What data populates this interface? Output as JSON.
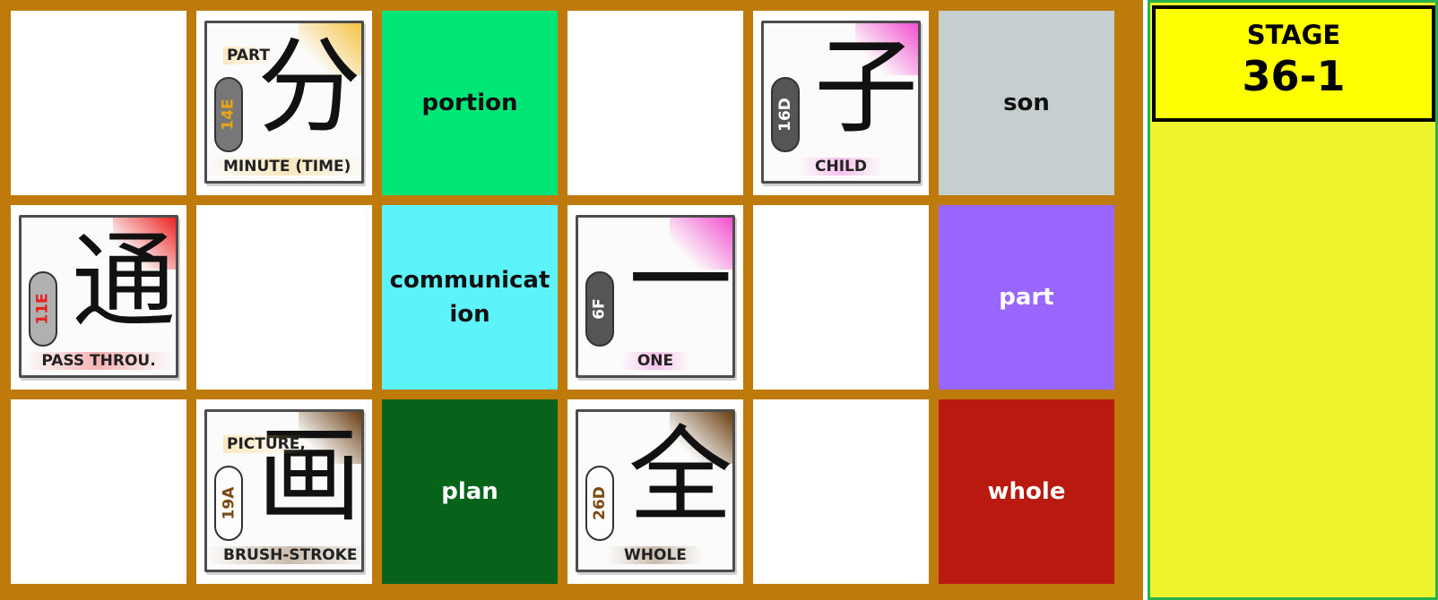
{
  "stage": {
    "label": "STAGE",
    "number": "36-1"
  },
  "colors": {
    "board": "#bf7a0c",
    "panel": "#eef52e",
    "panel_border": "#29b14e",
    "header": "#ffff00"
  },
  "cells": [
    {
      "type": "empty"
    },
    {
      "type": "kanji",
      "glyph": "分",
      "top": "PART",
      "bottom": "MINUTE (TIME)",
      "badge": "14E",
      "badge_text_color": "#e8a317",
      "badge_fill": "#777777",
      "accent": "#f5c242"
    },
    {
      "type": "word",
      "text": "portion",
      "bg": "#00e676",
      "fg": "#111111"
    },
    {
      "type": "empty"
    },
    {
      "type": "kanji",
      "glyph": "子",
      "top": "",
      "bottom": "CHILD",
      "badge": "16D",
      "badge_text_color": "#ffffff",
      "badge_fill": "#555555",
      "accent": "#f24fcf"
    },
    {
      "type": "word",
      "text": "son",
      "bg": "#c5cfcf",
      "fg": "#111111"
    },
    {
      "type": "kanji",
      "glyph": "通",
      "top": "",
      "bottom": "PASS THROU.",
      "badge": "11E",
      "badge_text_color": "#e8201e",
      "badge_fill": "#b0b0b0",
      "accent": "#ee2222"
    },
    {
      "type": "empty"
    },
    {
      "type": "word",
      "text": "communication",
      "bg": "#5cf4fa",
      "fg": "#111111"
    },
    {
      "type": "kanji",
      "glyph": "一",
      "top": "",
      "bottom": "ONE",
      "badge": "6F",
      "badge_text_color": "#ffffff",
      "badge_fill": "#555555",
      "accent": "#f24fcf"
    },
    {
      "type": "empty"
    },
    {
      "type": "word",
      "text": "part",
      "bg": "#9966ff",
      "fg": "#ffffff"
    },
    {
      "type": "empty"
    },
    {
      "type": "kanji",
      "glyph": "画",
      "top": "PICTURE,",
      "bottom": "BRUSH-STROKE",
      "badge": "19A",
      "badge_text_color": "#7a4a12",
      "badge_fill": "#fdfdfd",
      "accent": "#6b3f12"
    },
    {
      "type": "word",
      "text": "plan",
      "bg": "#07621a",
      "fg": "#ffffff"
    },
    {
      "type": "kanji",
      "glyph": "全",
      "top": "",
      "bottom": "WHOLE",
      "badge": "26D",
      "badge_text_color": "#7a4a12",
      "badge_fill": "#fdfdfd",
      "accent": "#6b3f12"
    },
    {
      "type": "empty"
    },
    {
      "type": "word",
      "text": "whole",
      "bg": "#b9190f",
      "fg": "#ffffff"
    }
  ]
}
